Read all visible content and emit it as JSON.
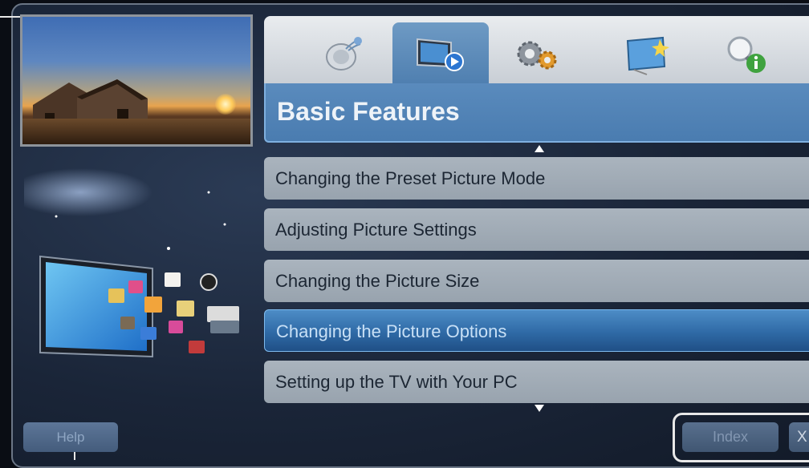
{
  "header": {
    "title": "Basic Features"
  },
  "tabs": [
    {
      "icon": "satellite-icon"
    },
    {
      "icon": "tv-play-icon",
      "active": true
    },
    {
      "icon": "gears-icon"
    },
    {
      "icon": "tv-sparkle-icon"
    },
    {
      "icon": "search-info-icon"
    }
  ],
  "menu": {
    "items": [
      {
        "label": "Changing the Preset Picture Mode"
      },
      {
        "label": "Adjusting Picture Settings"
      },
      {
        "label": "Changing the Picture Size"
      },
      {
        "label": "Changing the Picture Options",
        "selected": true
      },
      {
        "label": "Setting up the TV with Your PC"
      }
    ]
  },
  "footer": {
    "help_label": "Help",
    "index_label": "Index",
    "exit_label": "X"
  },
  "colors": {
    "accent": "#4a7cb0",
    "selected": "#2f6aa6"
  }
}
